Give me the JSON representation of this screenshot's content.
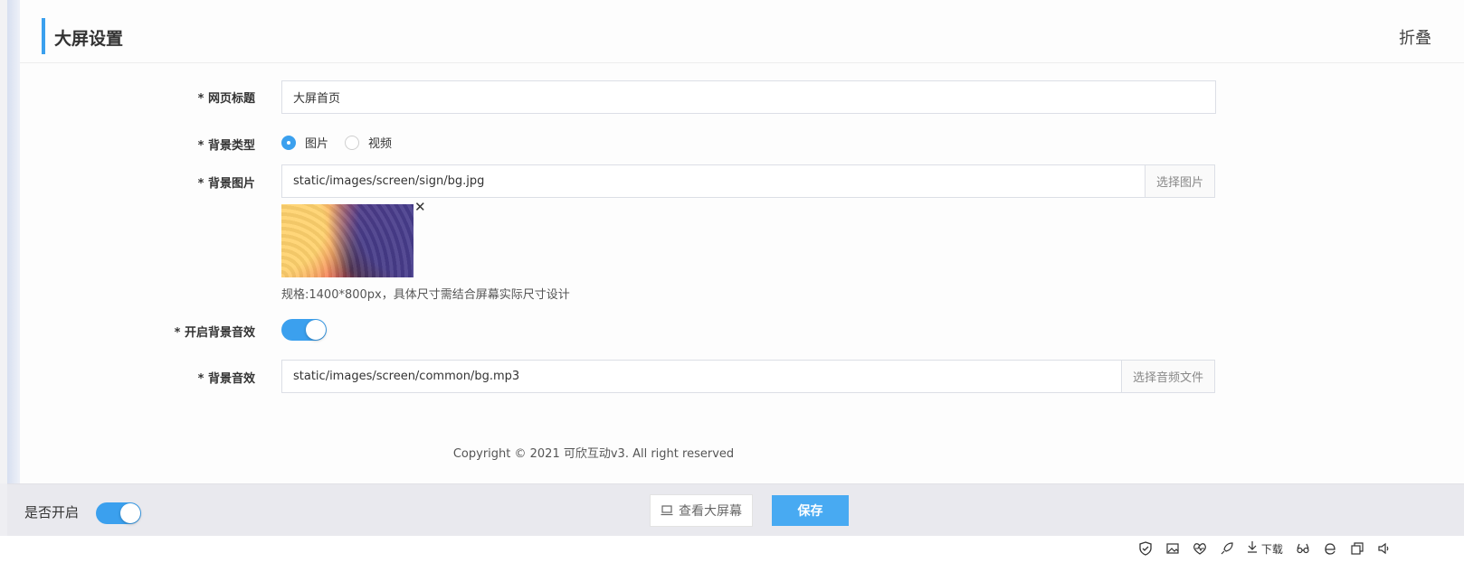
{
  "header": {
    "title": "大屏设置",
    "collapse_label": "折叠"
  },
  "form": {
    "page_title": {
      "label": "* 网页标题",
      "value": "大屏首页"
    },
    "bg_type": {
      "label": "* 背景类型",
      "options": [
        {
          "label": "图片",
          "checked": true
        },
        {
          "label": "视频",
          "checked": false
        }
      ]
    },
    "bg_image": {
      "label": "* 背景图片",
      "value": "static/images/screen/sign/bg.jpg",
      "button": "选择图片",
      "remove_glyph": "✕",
      "hint": "规格:1400*800px，具体尺寸需结合屏幕实际尺寸设计"
    },
    "bg_sound_enabled": {
      "label": "* 开启背景音效",
      "on": true
    },
    "bg_sound": {
      "label": "* 背景音效",
      "value": "static/images/screen/common/bg.mp3",
      "button": "选择音频文件"
    }
  },
  "copyright": "Copyright © 2021 可欣互动v3. All right reserved",
  "footer": {
    "enabled_label": "是否开启",
    "enabled_on": true,
    "view_button": "查看大屏幕",
    "save_button": "保存"
  },
  "statusbar": {
    "download_label": "下载"
  },
  "colors": {
    "accent": "#3ba0ee",
    "save": "#48aaf2"
  }
}
